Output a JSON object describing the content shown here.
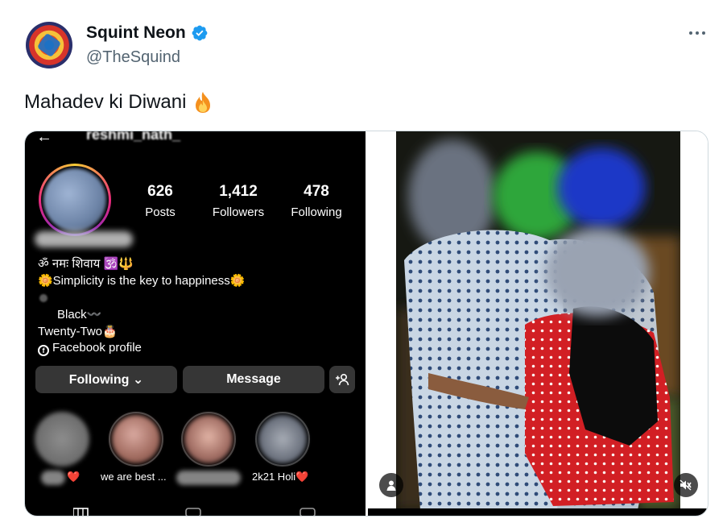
{
  "tweet": {
    "display_name": "Squint Neon",
    "handle": "@TheSquind",
    "text": "Mahadev ki Diwani"
  },
  "icons": {
    "verified": "verified-badge-icon",
    "more": "more-options-icon",
    "fire": "fire-emoji-icon"
  },
  "colors": {
    "verified_blue": "#1d9bf0",
    "text_primary": "#0f1419",
    "text_secondary": "#536471"
  },
  "instagram": {
    "username": "reshmi_nath_",
    "stats": [
      {
        "value": "626",
        "label": "Posts"
      },
      {
        "value": "1,412",
        "label": "Followers"
      },
      {
        "value": "478",
        "label": "Following"
      }
    ],
    "bio": {
      "line1": "ॐ नमः शिवाय 🕉️🔱",
      "line2": "🌼Simplicity is the key to happiness🌼",
      "line3": "Black〰️",
      "line4": "Twenty-Two🎂",
      "facebook": "Facebook profile"
    },
    "buttons": {
      "following": "Following ⌄",
      "message": "Message"
    },
    "highlights": [
      {
        "label": "❤️"
      },
      {
        "label": "we are best ..."
      },
      {
        "label": ""
      },
      {
        "label": "2k21 Holi❤️"
      }
    ]
  }
}
